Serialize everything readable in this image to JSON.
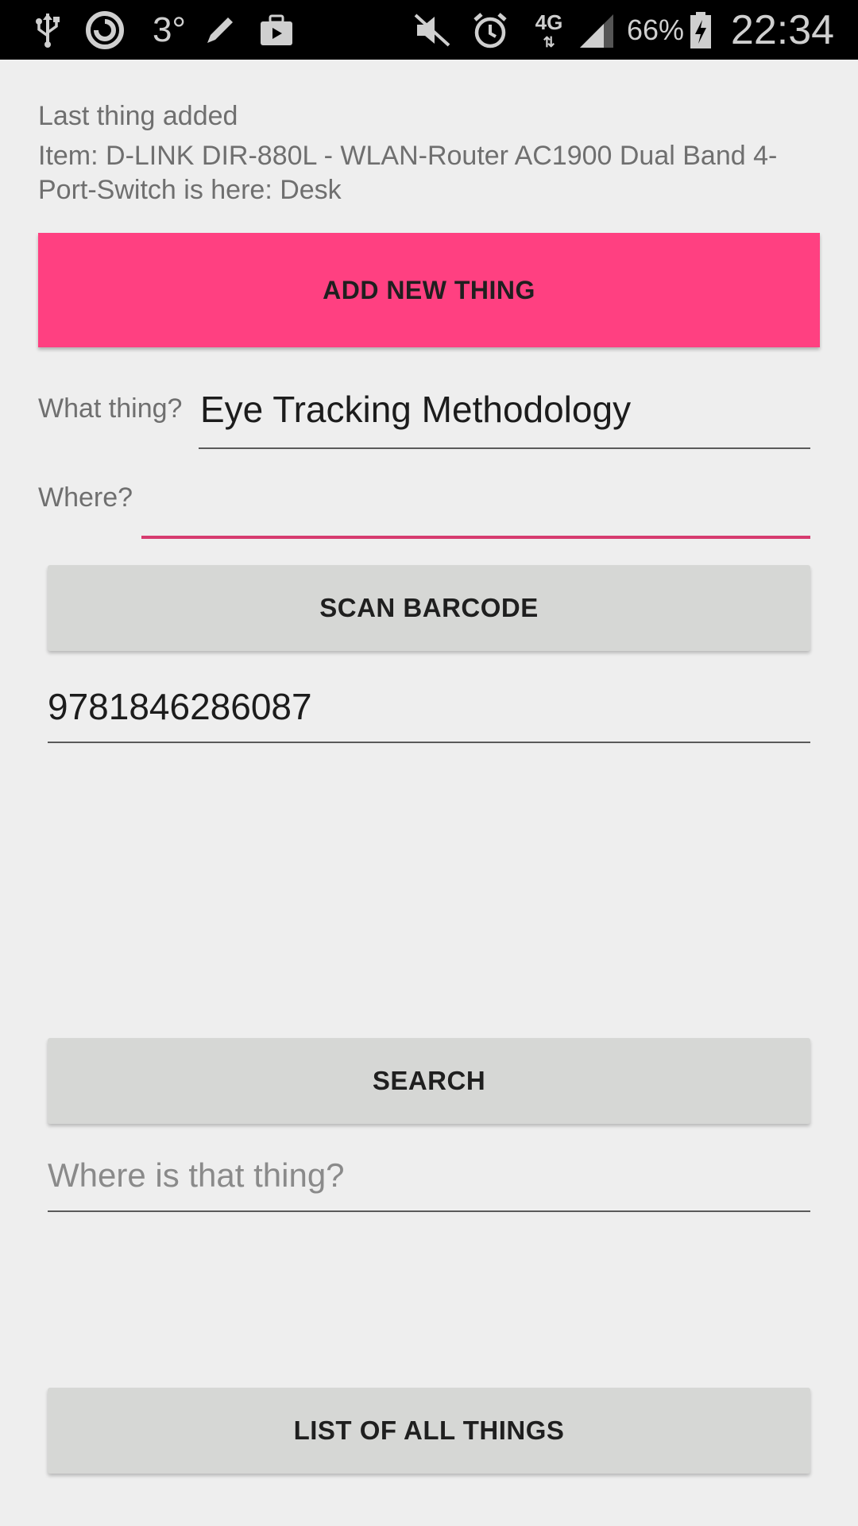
{
  "status_bar": {
    "network_temp": "3°",
    "network_type": "4G",
    "battery_percent": "66%",
    "time": "22:34",
    "icons": [
      "usb-icon",
      "swirl-icon",
      "pencil-icon",
      "briefcase-icon",
      "mute-icon",
      "alarm-icon",
      "signal-icon",
      "battery-charging-icon"
    ]
  },
  "last_added": {
    "heading": "Last thing added",
    "detail": "Item: D-LINK DIR-880L - WLAN-Router AC1900 Dual Band   4-Port-Switch is here: Desk"
  },
  "add_button": {
    "label": "ADD NEW THING",
    "color": "#ff4081"
  },
  "what_field": {
    "label": "What thing?",
    "value": "Eye Tracking Methodology"
  },
  "where_field": {
    "label": "Where?",
    "value": "",
    "focus_color": "#d63b6f"
  },
  "scan_button": {
    "label": "SCAN BARCODE"
  },
  "barcode_field": {
    "value": "9781846286087"
  },
  "search_button": {
    "label": "SEARCH"
  },
  "where_thing_field": {
    "placeholder": "Where is that thing?"
  },
  "list_button": {
    "label": "LIST OF ALL THINGS"
  }
}
